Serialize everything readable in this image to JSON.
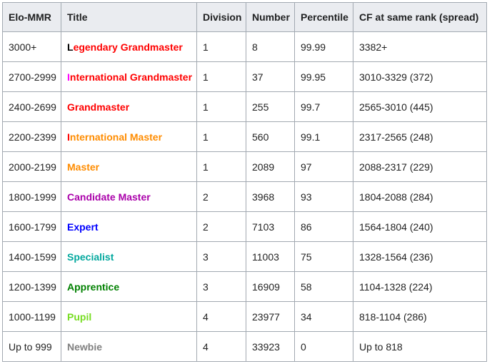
{
  "table": {
    "headers": [
      "Elo-MMR",
      "Title",
      "Division",
      "Number",
      "Percentile",
      "CF at same rank (spread)"
    ],
    "rows": [
      {
        "elo": "3000+",
        "title_first": "L",
        "title_rest": "egendary Grandmaster",
        "division": "1",
        "number": "8",
        "percentile": "99.99",
        "cf": "3382+",
        "color": "#ff0000",
        "first_color": "#000000"
      },
      {
        "elo": "2700-2999",
        "title_first": "I",
        "title_rest": "nternational Grandmaster",
        "division": "1",
        "number": "37",
        "percentile": "99.95",
        "cf": "3010-3329 (372)",
        "color": "#ff0000",
        "first_color": "#ff00ff"
      },
      {
        "elo": "2400-2699",
        "title_first": "",
        "title_rest": "Grandmaster",
        "division": "1",
        "number": "255",
        "percentile": "99.7",
        "cf": "2565-3010 (445)",
        "color": "#ff0000",
        "first_color": "#ff0000"
      },
      {
        "elo": "2200-2399",
        "title_first": "I",
        "title_rest": "nternational Master",
        "division": "1",
        "number": "560",
        "percentile": "99.1",
        "cf": "2317-2565 (248)",
        "color": "#ff8c00",
        "first_color": "#ff0000"
      },
      {
        "elo": "2000-2199",
        "title_first": "",
        "title_rest": "Master",
        "division": "1",
        "number": "2089",
        "percentile": "97",
        "cf": "2088-2317 (229)",
        "color": "#ff8c00",
        "first_color": "#ff8c00"
      },
      {
        "elo": "1800-1999",
        "title_first": "",
        "title_rest": "Candidate Master",
        "division": "2",
        "number": "3968",
        "percentile": "93",
        "cf": "1804-2088 (284)",
        "color": "#aa00aa",
        "first_color": "#aa00aa"
      },
      {
        "elo": "1600-1799",
        "title_first": "",
        "title_rest": "Expert",
        "division": "2",
        "number": "7103",
        "percentile": "86",
        "cf": "1564-1804 (240)",
        "color": "#0000ff",
        "first_color": "#0000ff"
      },
      {
        "elo": "1400-1599",
        "title_first": "",
        "title_rest": "Specialist",
        "division": "3",
        "number": "11003",
        "percentile": "75",
        "cf": "1328-1564 (236)",
        "color": "#03a89e",
        "first_color": "#03a89e"
      },
      {
        "elo": "1200-1399",
        "title_first": "",
        "title_rest": "Apprentice",
        "division": "3",
        "number": "16909",
        "percentile": "58",
        "cf": "1104-1328 (224)",
        "color": "#008000",
        "first_color": "#008000"
      },
      {
        "elo": "1000-1199",
        "title_first": "",
        "title_rest": "Pupil",
        "division": "4",
        "number": "23977",
        "percentile": "34",
        "cf": "818-1104 (286)",
        "color": "#77dd22",
        "first_color": "#77dd22"
      },
      {
        "elo": "Up to 999",
        "title_first": "",
        "title_rest": "Newbie",
        "division": "4",
        "number": "33923",
        "percentile": "0",
        "cf": "Up to 818",
        "color": "#808080",
        "first_color": "#808080"
      }
    ]
  }
}
